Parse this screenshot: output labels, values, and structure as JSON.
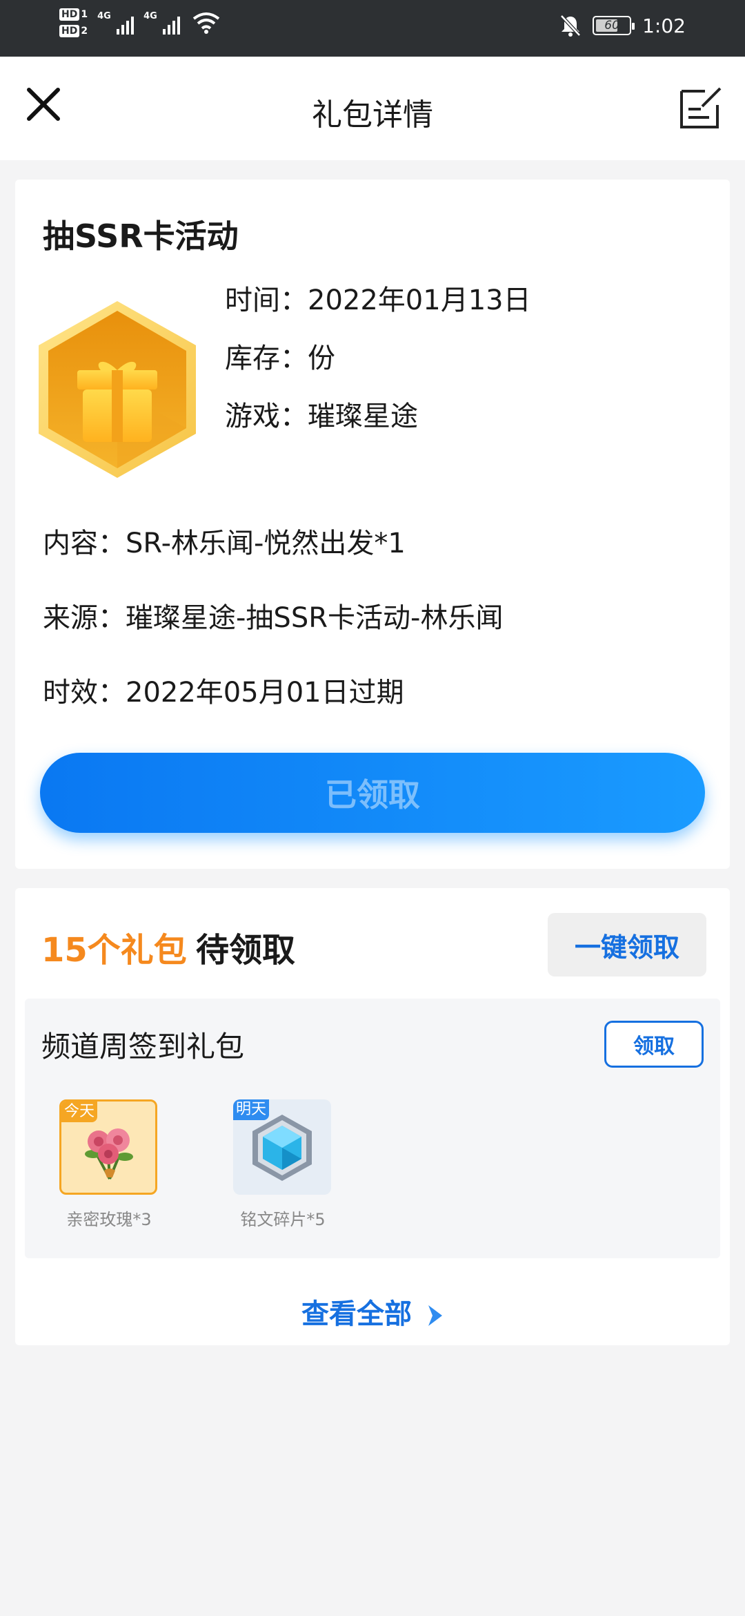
{
  "status_bar": {
    "sim1_badge": "HD",
    "sim1_number": "1",
    "sim2_badge": "HD",
    "sim2_number": "2",
    "network_1": "4G",
    "network_2": "4G",
    "battery_level": "60",
    "time": "1:02"
  },
  "header": {
    "title": "礼包详情",
    "close_icon": "close-icon",
    "edit_icon": "edit-note-icon"
  },
  "gift": {
    "name": "抽SSR卡活动",
    "icon": "gift-box-hexagon-icon",
    "time_label": "时间：",
    "time_value": "2022年01月13日",
    "stock_label": "库存：",
    "stock_value": "份",
    "game_label": "游戏：",
    "game_value": "璀璨星途",
    "content_label": "内容：",
    "content_value": "SR-林乐闻-悦然出发*1",
    "source_label": "来源：",
    "source_value": "璀璨星途-抽SSR卡活动-林乐闻",
    "validity_label": "时效：",
    "validity_value": "2022年05月01日过期",
    "claim_button": "已领取"
  },
  "pending": {
    "count_text": "15个礼包",
    "label": "待领取",
    "one_key_button": "一键领取",
    "channel": {
      "title": "频道周签到礼包",
      "get_button": "领取",
      "items": [
        {
          "tag": "今天",
          "label": "亲密玫瑰*3",
          "icon": "rose-bouquet-icon",
          "tag_color": "#f5a623"
        },
        {
          "tag": "明天",
          "label": "铭文碎片*5",
          "icon": "crystal-hexagon-icon",
          "tag_color": "#2f8cf0"
        }
      ]
    },
    "see_all": "查看全部"
  },
  "colors": {
    "accent_blue": "#1670e0",
    "accent_orange": "#f5891e",
    "status_bar": "#2d3033"
  }
}
